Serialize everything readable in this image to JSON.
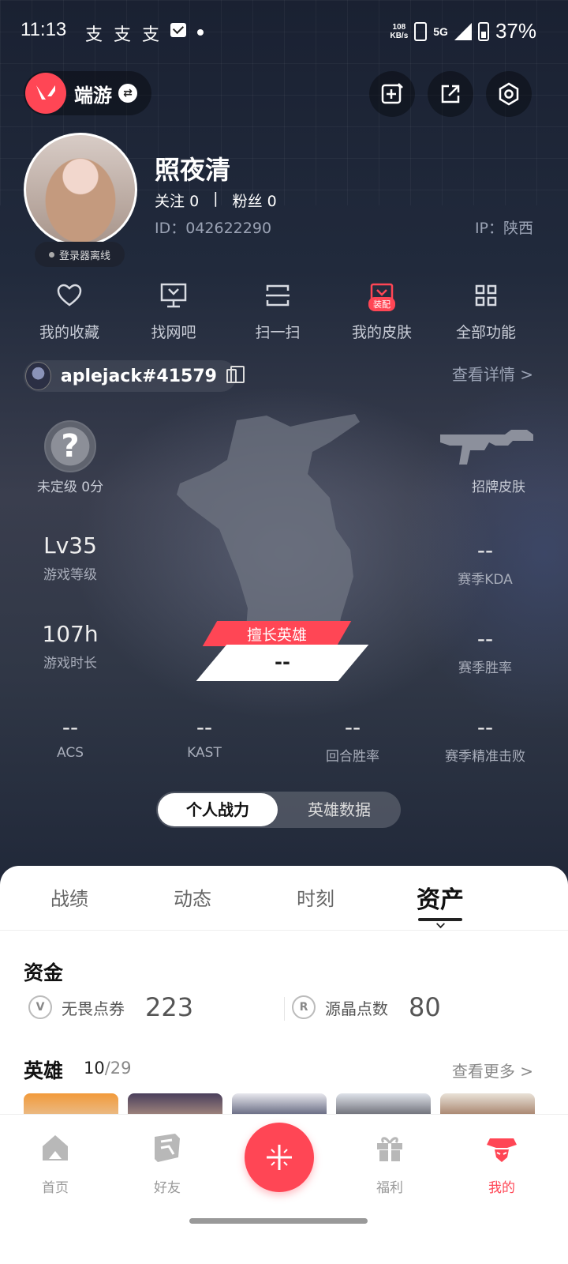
{
  "status_bar": {
    "time": "11:13",
    "notif_glyphs": [
      "支",
      "支",
      "支"
    ],
    "net_speed_value": "108",
    "net_speed_unit": "KB/s",
    "network": "5G",
    "battery": "37%"
  },
  "header": {
    "game_name": "端游",
    "icons": [
      "edit-card-icon",
      "share-icon",
      "settings-icon"
    ]
  },
  "profile": {
    "nickname": "照夜清",
    "following_label": "关注",
    "following_count": "0",
    "divider": "|",
    "fans_label": "粉丝",
    "fans_count": "0",
    "uid": "ID：042622290",
    "ip": "IP：陕西",
    "status": "登录器离线"
  },
  "quick_actions": [
    {
      "label": "我的收藏",
      "icon": "heart-icon"
    },
    {
      "label": "找网吧",
      "icon": "monitor-icon"
    },
    {
      "label": "扫一扫",
      "icon": "scan-icon"
    },
    {
      "label": "我的皮肤",
      "icon": "skin-icon",
      "badge": "装配"
    },
    {
      "label": "全部功能",
      "icon": "grid-icon"
    }
  ],
  "riot": {
    "riot_id": "aplejack#41579",
    "view_detail": "查看详情 >"
  },
  "stats": {
    "rank_label": "未定级 0分",
    "rank_symbol": "?",
    "signature_skin_label": "招牌皮肤",
    "level_value": "Lv35",
    "level_label": "游戏等级",
    "playtime_value": "107h",
    "playtime_label": "游戏时长",
    "kda_value": "--",
    "kda_label": "赛季KDA",
    "winrate_value": "--",
    "winrate_label": "赛季胜率",
    "acs_value": "--",
    "acs_label": "ACS",
    "kast_value": "--",
    "kast_label": "KAST",
    "round_win_value": "--",
    "round_win_label": "回合胜率",
    "headshot_value": "--",
    "headshot_label": "赛季精准击败",
    "best_agent_title": "擅长英雄",
    "best_agent_value": "--"
  },
  "toggle": {
    "active": "个人战力",
    "inactive": "英雄数据"
  },
  "tabs": [
    "战绩",
    "动态",
    "时刻",
    "资产"
  ],
  "assets": {
    "funds_title": "资金",
    "vp_label": "无畏点券",
    "vp_value": "223",
    "rp_label": "源晶点数",
    "rp_value": "80",
    "heroes_title": "英雄",
    "heroes_owned": "10",
    "heroes_total": "/29",
    "see_more": "查看更多 >"
  },
  "bottom_nav": [
    {
      "label": "首页",
      "icon": "home-icon"
    },
    {
      "label": "好友",
      "icon": "friends-icon"
    },
    {
      "label": "福利",
      "icon": "gift-icon"
    },
    {
      "label": "我的",
      "icon": "profile-icon"
    }
  ],
  "colors": {
    "accent": "#ff4655",
    "hero_bg": "#212a3c"
  }
}
